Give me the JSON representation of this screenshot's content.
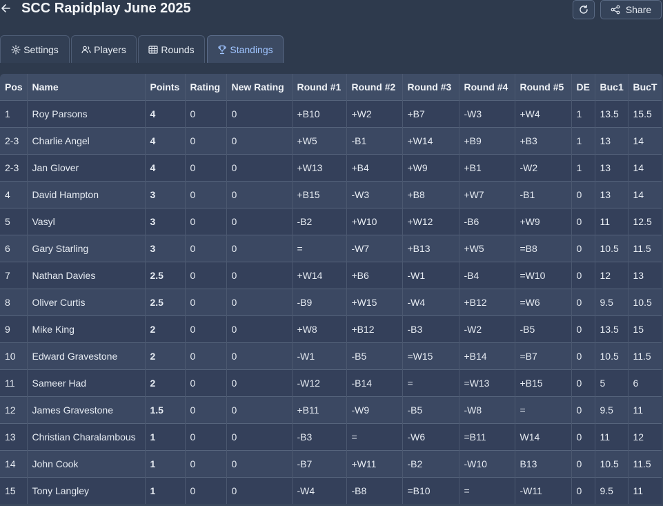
{
  "header": {
    "title": "SCC Rapidplay June 2025",
    "share_label": "Share"
  },
  "tabs": [
    {
      "label": "Settings",
      "icon": "gear-icon"
    },
    {
      "label": "Players",
      "icon": "users-icon"
    },
    {
      "label": "Rounds",
      "icon": "grid-icon"
    },
    {
      "label": "Standings",
      "icon": "trophy-icon",
      "active": true
    }
  ],
  "colors": {
    "background": "#2e3a4d",
    "active_tab_text": "#9fc4ff"
  },
  "table": {
    "columns": [
      "Pos",
      "Name",
      "Points",
      "Rating",
      "New Rating",
      "Round #1",
      "Round #2",
      "Round #3",
      "Round #4",
      "Round #5",
      "DE",
      "Buc1",
      "BucT"
    ],
    "rows": [
      [
        "1",
        "Roy Parsons",
        "4",
        "0",
        "0",
        "+B10",
        "+W2",
        "+B7",
        "-W3",
        "+W4",
        "1",
        "13.5",
        "15.5"
      ],
      [
        "2-3",
        "Charlie Angel",
        "4",
        "0",
        "0",
        "+W5",
        "-B1",
        "+W14",
        "+B9",
        "+B3",
        "1",
        "13",
        "14"
      ],
      [
        "2-3",
        "Jan Glover",
        "4",
        "0",
        "0",
        "+W13",
        "+B4",
        "+W9",
        "+B1",
        "-W2",
        "1",
        "13",
        "14"
      ],
      [
        "4",
        "David Hampton",
        "3",
        "0",
        "0",
        "+B15",
        "-W3",
        "+B8",
        "+W7",
        "-B1",
        "0",
        "13",
        "14"
      ],
      [
        "5",
        "Vasyl",
        "3",
        "0",
        "0",
        "-B2",
        "+W10",
        "+W12",
        "-B6",
        "+W9",
        "0",
        "11",
        "12.5"
      ],
      [
        "6",
        "Gary Starling",
        "3",
        "0",
        "0",
        "=",
        "-W7",
        "+B13",
        "+W5",
        "=B8",
        "0",
        "10.5",
        "11.5"
      ],
      [
        "7",
        "Nathan Davies",
        "2.5",
        "0",
        "0",
        "+W14",
        "+B6",
        "-W1",
        "-B4",
        "=W10",
        "0",
        "12",
        "13"
      ],
      [
        "8",
        "Oliver Curtis",
        "2.5",
        "0",
        "0",
        "-B9",
        "+W15",
        "-W4",
        "+B12",
        "=W6",
        "0",
        "9.5",
        "10.5"
      ],
      [
        "9",
        "Mike King",
        "2",
        "0",
        "0",
        "+W8",
        "+B12",
        "-B3",
        "-W2",
        "-B5",
        "0",
        "13.5",
        "15"
      ],
      [
        "10",
        "Edward Gravestone",
        "2",
        "0",
        "0",
        "-W1",
        "-B5",
        "=W15",
        "+B14",
        "=B7",
        "0",
        "10.5",
        "11.5"
      ],
      [
        "11",
        "Sameer Had",
        "2",
        "0",
        "0",
        "-W12",
        "-B14",
        "=",
        "=W13",
        "+B15",
        "0",
        "5",
        "6"
      ],
      [
        "12",
        "James Gravestone",
        "1.5",
        "0",
        "0",
        "+B11",
        "-W9",
        "-B5",
        "-W8",
        "=",
        "0",
        "9.5",
        "11"
      ],
      [
        "13",
        "Christian Charalambous",
        "1",
        "0",
        "0",
        "-B3",
        "=",
        "-W6",
        "=B11",
        "W14",
        "0",
        "11",
        "12"
      ],
      [
        "14",
        "John Cook",
        "1",
        "0",
        "0",
        "-B7",
        "+W11",
        "-B2",
        "-W10",
        "B13",
        "0",
        "10.5",
        "11.5"
      ],
      [
        "15",
        "Tony Langley",
        "1",
        "0",
        "0",
        "-W4",
        "-B8",
        "=B10",
        "=",
        "-W11",
        "0",
        "9.5",
        "11"
      ]
    ]
  }
}
